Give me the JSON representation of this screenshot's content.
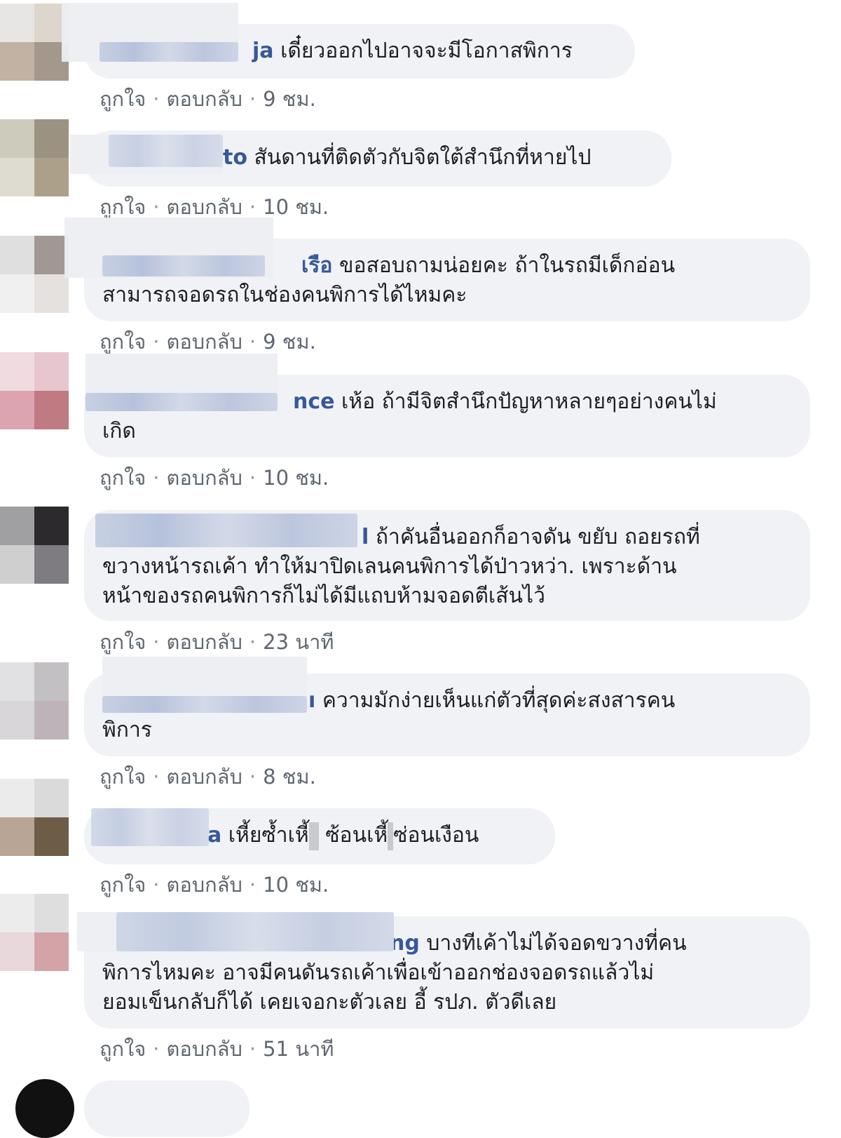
{
  "meta_labels": {
    "like": "ถูกใจ",
    "reply": "ตอบกลับ",
    "separator": "·"
  },
  "comments": [
    {
      "name": "ja",
      "text": "เดี๋ยวออกไปอาจจะมีโอกาสพิการ",
      "time": "9 ชม."
    },
    {
      "name": "to",
      "text": "สันดานที่ติดตัวกับจิตใต้สำนึกที่หายไป",
      "time": "10 ชม."
    },
    {
      "name": "เรือ",
      "text": "ขอสอบถามน่อยคะ ถ้าในรถมีเด็กอ่อน",
      "text2": "สามารถจอดรถในช่องคนพิการได้ไหมคะ",
      "time": "9 ชม."
    },
    {
      "name": "nce",
      "text": "เห้อ ถ้ามีจิตสำนึกปัญหาหลายๆอย่างคนไม่",
      "text2": "เกิด",
      "time": "10 ชม."
    },
    {
      "name": "l",
      "text": "ถ้าคันอื่นออกก็อาจดัน ขยับ ถอยรถที่",
      "text2": "ขวางหน้ารถเค้า ทำให้มาปิดเลนคนพิการได้ป่าวหว่า. เพราะด้าน",
      "text3": "หน้าของรถคนพิการก็ไม่ได้มีแถบห้ามจอดตีเส้นไว้",
      "time": "23 นาที"
    },
    {
      "name": "ı",
      "text": "ความมักง่ายเห็นแก่ตัวที่สุดค่ะสงสารคน",
      "text2": "พิการ",
      "time": "8 ชม."
    },
    {
      "name": "a",
      "text_a": "เหี้ยซ้ำเหี้",
      "text_b": "ซ้อนเหี้",
      "text_c": "ซ่อนเงือน",
      "time": "10 ชม."
    },
    {
      "name": "ng",
      "text": "บางทีเค้าไม่ได้จอดขวางที่คน",
      "text2": "พิการไหมคะ อาจมีคนดันรถเค้าเพื่อเข้าออกช่องจอดรถแล้วไม่",
      "text3": "ยอมเข็นกลับก็ได้ เคยเจอกะตัวเลย อี้ รปภ. ตัวดีเลย",
      "time": "51 นาที"
    }
  ]
}
